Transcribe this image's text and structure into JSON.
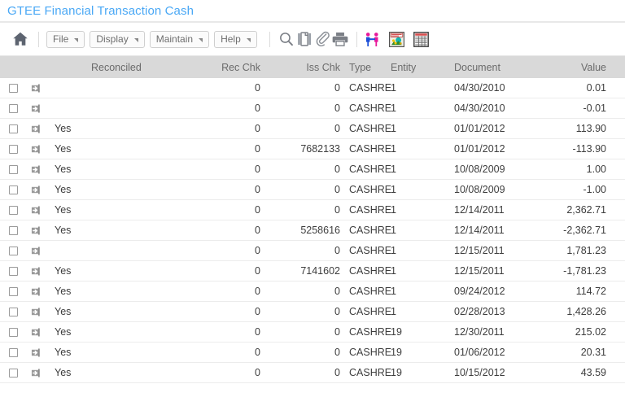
{
  "window": {
    "title": "GTEE Financial Transaction Cash"
  },
  "toolbar": {
    "home_icon": "home-icon",
    "menus": [
      {
        "label": "File",
        "name": "menu-file"
      },
      {
        "label": "Display",
        "name": "menu-display"
      },
      {
        "label": "Maintain",
        "name": "menu-maintain"
      },
      {
        "label": "Help",
        "name": "menu-help"
      }
    ],
    "icons": [
      {
        "name": "search-icon",
        "title": "Search"
      },
      {
        "name": "copy-icon",
        "title": "Copy"
      },
      {
        "name": "attachment-icon",
        "title": "Attachment"
      },
      {
        "name": "print-icon",
        "title": "Print"
      }
    ],
    "color_icons": [
      {
        "name": "people-icon",
        "title": "People"
      },
      {
        "name": "chart-image-icon",
        "title": "Chart"
      },
      {
        "name": "spreadsheet-icon",
        "title": "Spreadsheet"
      }
    ]
  },
  "grid": {
    "columns": [
      {
        "key": "reconciled",
        "label": "Reconciled"
      },
      {
        "key": "rec_chk",
        "label": "Rec Chk"
      },
      {
        "key": "iss_chk",
        "label": "Iss Chk"
      },
      {
        "key": "type",
        "label": "Type"
      },
      {
        "key": "entity",
        "label": "Entity"
      },
      {
        "key": "document",
        "label": "Document"
      },
      {
        "key": "value",
        "label": "Value"
      }
    ],
    "rows": [
      {
        "reconciled": "",
        "rec_chk": "0",
        "iss_chk": "0",
        "type": "CASHRE",
        "entity": "1",
        "document": "04/30/2010",
        "value": "0.01"
      },
      {
        "reconciled": "",
        "rec_chk": "0",
        "iss_chk": "0",
        "type": "CASHRE",
        "entity": "1",
        "document": "04/30/2010",
        "value": "-0.01"
      },
      {
        "reconciled": "Yes",
        "rec_chk": "0",
        "iss_chk": "0",
        "type": "CASHRE",
        "entity": "1",
        "document": "01/01/2012",
        "value": "113.90"
      },
      {
        "reconciled": "Yes",
        "rec_chk": "0",
        "iss_chk": "7682133",
        "type": "CASHRE",
        "entity": "1",
        "document": "01/01/2012",
        "value": "-113.90"
      },
      {
        "reconciled": "Yes",
        "rec_chk": "0",
        "iss_chk": "0",
        "type": "CASHRE",
        "entity": "1",
        "document": "10/08/2009",
        "value": "1.00"
      },
      {
        "reconciled": "Yes",
        "rec_chk": "0",
        "iss_chk": "0",
        "type": "CASHRE",
        "entity": "1",
        "document": "10/08/2009",
        "value": "-1.00"
      },
      {
        "reconciled": "Yes",
        "rec_chk": "0",
        "iss_chk": "0",
        "type": "CASHRE",
        "entity": "1",
        "document": "12/14/2011",
        "value": "2,362.71"
      },
      {
        "reconciled": "Yes",
        "rec_chk": "0",
        "iss_chk": "5258616",
        "type": "CASHRE",
        "entity": "1",
        "document": "12/14/2011",
        "value": "-2,362.71"
      },
      {
        "reconciled": "",
        "rec_chk": "0",
        "iss_chk": "0",
        "type": "CASHRE",
        "entity": "1",
        "document": "12/15/2011",
        "value": "1,781.23"
      },
      {
        "reconciled": "Yes",
        "rec_chk": "0",
        "iss_chk": "7141602",
        "type": "CASHRE",
        "entity": "1",
        "document": "12/15/2011",
        "value": "-1,781.23"
      },
      {
        "reconciled": "Yes",
        "rec_chk": "0",
        "iss_chk": "0",
        "type": "CASHRE",
        "entity": "1",
        "document": "09/24/2012",
        "value": "114.72"
      },
      {
        "reconciled": "Yes",
        "rec_chk": "0",
        "iss_chk": "0",
        "type": "CASHRE",
        "entity": "1",
        "document": "02/28/2013",
        "value": "1,428.26"
      },
      {
        "reconciled": "Yes",
        "rec_chk": "0",
        "iss_chk": "0",
        "type": "CASHRE",
        "entity": "19",
        "document": "12/30/2011",
        "value": "215.02"
      },
      {
        "reconciled": "Yes",
        "rec_chk": "0",
        "iss_chk": "0",
        "type": "CASHRE",
        "entity": "19",
        "document": "01/06/2012",
        "value": "20.31"
      },
      {
        "reconciled": "Yes",
        "rec_chk": "0",
        "iss_chk": "0",
        "type": "CASHRE",
        "entity": "19",
        "document": "10/15/2012",
        "value": "43.59"
      }
    ]
  },
  "colors": {
    "title": "#4aa8f5",
    "header_bg": "#d9d9d9",
    "header_text": "#6b6b6b",
    "row_text": "#3d3d3d",
    "row_border": "#ececec"
  }
}
